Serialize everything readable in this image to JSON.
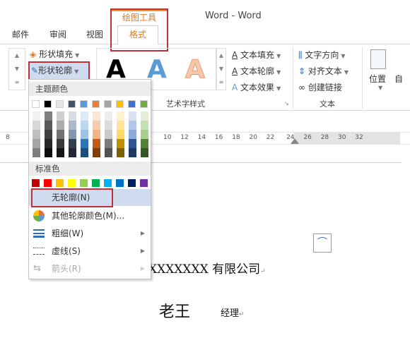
{
  "window": {
    "title": "Word - Word"
  },
  "contextual_tab": {
    "group_label": "绘图工具",
    "tab_label": "格式"
  },
  "tabs": [
    "邮件",
    "审阅",
    "视图"
  ],
  "ribbon": {
    "shape_fill": "形状填充",
    "shape_outline": "形状轮廓",
    "wordart_group": "艺术字样式",
    "wordart_sample": "A",
    "text_fill": "文本填充",
    "text_outline": "文本轮廓",
    "text_effect": "文本效果",
    "text_direction": "文字方向",
    "align_text": "对齐文本",
    "create_link": "创建链接",
    "text_group": "文本",
    "position": "位置",
    "wrap_partial": "自"
  },
  "ruler": {
    "left_tick": "8",
    "ticks": [
      "10",
      "12",
      "14",
      "16",
      "18",
      "20",
      "22",
      "24",
      "26",
      "28",
      "30",
      "32"
    ]
  },
  "menu": {
    "theme_colors_label": "主题颜色",
    "theme_colors": [
      "#ffffff",
      "#000000",
      "#e7e6e6",
      "#44546a",
      "#5b9bd5",
      "#ed7d31",
      "#a5a5a5",
      "#ffc000",
      "#4472c4",
      "#70ad47"
    ],
    "theme_shades": [
      [
        "#f2f2f2",
        "#7f7f7f",
        "#d0cece",
        "#d6dce4",
        "#deebf6",
        "#fbe5d5",
        "#ededed",
        "#fff2cc",
        "#d9e2f3",
        "#e2efd9"
      ],
      [
        "#d8d8d8",
        "#595959",
        "#aeabab",
        "#adb9ca",
        "#bdd7ee",
        "#f7cbac",
        "#dbdbdb",
        "#fee599",
        "#b4c6e7",
        "#c5e0b3"
      ],
      [
        "#bfbfbf",
        "#3f3f3f",
        "#757070",
        "#8496b0",
        "#9cc3e5",
        "#f4b183",
        "#c9c9c9",
        "#ffd965",
        "#8eaadb",
        "#a8d08d"
      ],
      [
        "#a5a5a5",
        "#262626",
        "#3a3838",
        "#323f4f",
        "#2e75b5",
        "#c55a11",
        "#7b7b7b",
        "#bf9000",
        "#2f5496",
        "#538135"
      ],
      [
        "#7f7f7f",
        "#0c0c0c",
        "#171616",
        "#222a35",
        "#1e4e79",
        "#833c0b",
        "#525252",
        "#7f6000",
        "#1f3864",
        "#375623"
      ]
    ],
    "standard_colors_label": "标准色",
    "standard_colors": [
      "#c00000",
      "#ff0000",
      "#ffc000",
      "#ffff00",
      "#92d050",
      "#00b050",
      "#00b0f0",
      "#0070c0",
      "#002060",
      "#7030a0"
    ],
    "items": [
      {
        "label": "无轮廓(N)",
        "icon": "none",
        "highlighted": true
      },
      {
        "label": "其他轮廓颜色(M)...",
        "icon": "color-wheel-icon"
      },
      {
        "label": "粗细(W)",
        "icon": "line-weight-icon",
        "submenu": true
      },
      {
        "label": "虚线(S)",
        "icon": "dashes-icon",
        "submenu": true
      },
      {
        "label": "箭头(R)",
        "icon": "arrows-icon",
        "submenu": true,
        "disabled": true
      }
    ]
  },
  "document": {
    "company": "XXXXXXX 有限公司",
    "mark": "↵",
    "name": "老王",
    "role": "经理"
  },
  "colors": {
    "accent": "#d57a20",
    "highlight": "#c0303a",
    "menu_hover": "#cfdcef"
  }
}
